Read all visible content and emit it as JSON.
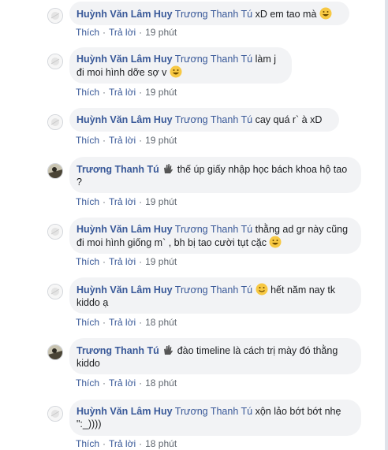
{
  "reply_label": "Trả lời",
  "like_label": "Thích",
  "separator": "·",
  "colors": {
    "link": "#385898",
    "bubble": "#f2f3f5",
    "meta": "#606770"
  },
  "comments": [
    {
      "author": "Huỳnh Văn Lâm Huy",
      "mention": "Trương Thanh Tú",
      "text": "xD em tao mà",
      "time": "19 phút",
      "avatar": "avatar-white",
      "emoji_after": "grin-emoji"
    },
    {
      "author": "Huỳnh Văn Lâm Huy",
      "mention": "Trương Thanh Tú",
      "text": "làm j đi moi hình dỡe sợ v",
      "time": "19 phút",
      "avatar": "avatar-white",
      "emoji_after": "grin-emoji"
    },
    {
      "author": "Huỳnh Văn Lâm Huy",
      "mention": "Trương Thanh Tú",
      "text": "cay quá r` à xD",
      "time": "19 phút",
      "avatar": "avatar-white"
    },
    {
      "author": "Trương Thanh Tú",
      "text": "thế úp giấy nhập học bách khoa hộ tao ?",
      "time": "19 phút",
      "avatar": "avatar-dark",
      "emoji_before": "hand-emoji"
    },
    {
      "author": "Huỳnh Văn Lâm Huy",
      "mention": "Trương Thanh Tú",
      "text": "thằng ad gr này cũng đi moi hình giống m` , bh bị tao cười tụt cặc",
      "time": "19 phút",
      "avatar": "avatar-white",
      "emoji_after": "grin-emoji"
    },
    {
      "author": "Huỳnh Văn Lâm Huy",
      "mention": "Trương Thanh Tú",
      "text": "hết năm nay tk kiddo ạ",
      "time": "18 phút",
      "avatar": "avatar-white",
      "emoji_before": "smile-emoji"
    },
    {
      "author": "Trương Thanh Tú",
      "text": "đào timeline là cách trị mày đó thằng kiddo",
      "time": "18 phút",
      "avatar": "avatar-dark",
      "emoji_before": "hand-emoji"
    },
    {
      "author": "Huỳnh Văn Lâm Huy",
      "mention": "Trương Thanh Tú",
      "text": "xộn lảo bớt bớt nhẹ \":_))))",
      "time": "18 phút",
      "avatar": "avatar-white"
    }
  ]
}
